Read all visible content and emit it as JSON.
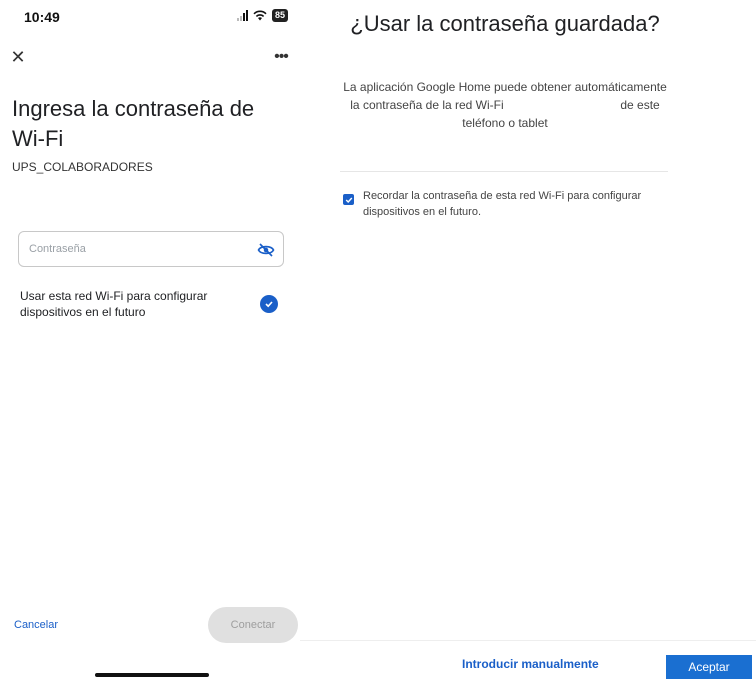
{
  "status_bar": {
    "time": "10:49",
    "battery": "85"
  },
  "wifi_screen": {
    "close_icon": "close-icon",
    "more_icon": "more-icon",
    "title": "Ingresa la contraseña de Wi-Fi",
    "network_name": "UPS_COLABORADORES",
    "password": {
      "value": "",
      "placeholder": "Contraseña"
    },
    "use_network_label": "Usar esta red Wi-Fi para configurar dispositivos en el futuro",
    "use_network_checked": true,
    "cancel_label": "Cancelar",
    "connect_label": "Conectar"
  },
  "dialog": {
    "title": "¿Usar la contraseña guardada?",
    "body_part1": "La aplicación Google Home puede obtener automáticamente la contraseña de la red Wi-Fi",
    "body_part2": "de este teléfono o tablet",
    "remember_label": "Recordar la contraseña de esta red Wi-Fi para configurar dispositivos en el futuro.",
    "remember_checked": true,
    "manual_label": "Introducir manualmente",
    "accept_label": "Aceptar"
  },
  "colors": {
    "accent": "#1a5fc8",
    "accept_button": "#1a6fd1",
    "disabled_button": "#e0e0e0"
  }
}
